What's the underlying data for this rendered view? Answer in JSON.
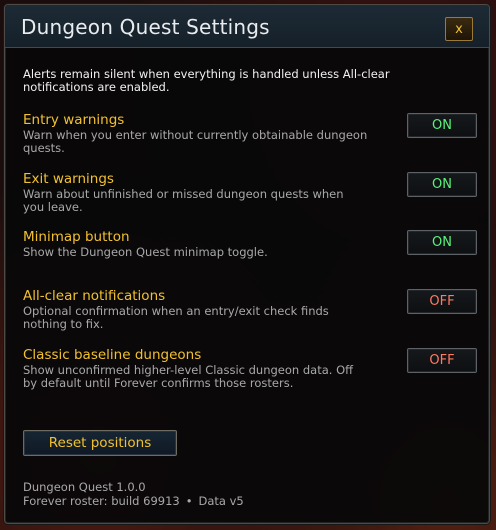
{
  "window": {
    "title": "Dungeon Quest Settings",
    "close_label": "x"
  },
  "intro": "Alerts remain silent when everything is handled unless All-clear notifications are enabled.",
  "settings": [
    {
      "label": "Entry warnings",
      "description": "Warn when you enter without currently obtainable dungeon quests.",
      "state": "ON"
    },
    {
      "label": "Exit warnings",
      "description": "Warn about unfinished or missed dungeon quests when you leave.",
      "state": "ON"
    },
    {
      "label": "Minimap button",
      "description": "Show the Dungeon Quest minimap toggle.",
      "state": "ON"
    },
    {
      "label": "All-clear notifications",
      "description": "Optional confirmation when an entry/exit check finds nothing to fix.",
      "state": "OFF"
    },
    {
      "label": "Classic baseline dungeons",
      "description": "Show unconfirmed higher-level Classic dungeon data. Off by default until Forever confirms those rosters.",
      "state": "OFF"
    }
  ],
  "reset_label": "Reset positions",
  "footer": {
    "version": "Dungeon Quest 1.0.0",
    "roster": "Forever roster: build 69913",
    "separator": "•",
    "data_version": "Data v5"
  },
  "colors": {
    "label": "#f2c12e",
    "on": "#5cf27a",
    "off": "#ff7a61"
  }
}
